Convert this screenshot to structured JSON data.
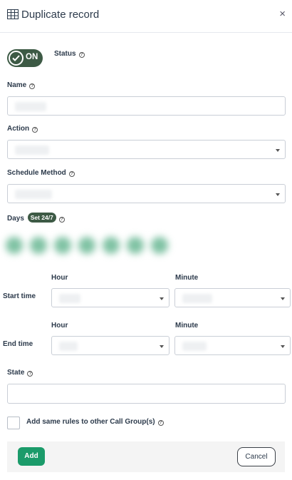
{
  "header": {
    "title": "Duplicate record",
    "close_label": "×"
  },
  "status": {
    "toggle_label": "ON",
    "label": "Status",
    "enabled": true
  },
  "fields": {
    "name_label": "Name",
    "action_label": "Action",
    "schedule_method_label": "Schedule Method",
    "days_label": "Days",
    "days_badge": "Set 24/7",
    "state_label": "State"
  },
  "time": {
    "hour_label": "Hour",
    "minute_label": "Minute",
    "start_label": "Start time",
    "end_label": "End time"
  },
  "extra": {
    "same_rules_label": "Add same rules to other Call Group(s)"
  },
  "footer": {
    "add_label": "Add",
    "cancel_label": "Cancel"
  },
  "colors": {
    "toggle_bg": "#3d5a45",
    "add_button": "#1b9b6a",
    "day_circle": "#7fc2a3"
  }
}
